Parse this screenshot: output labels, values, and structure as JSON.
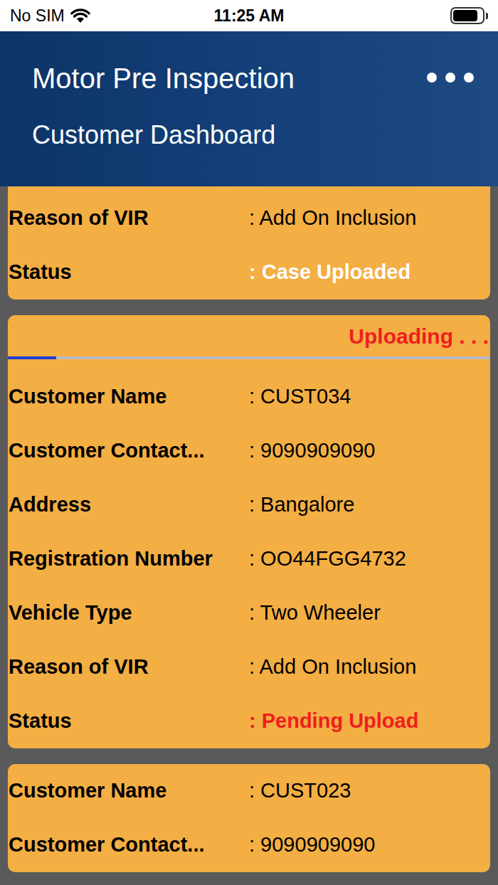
{
  "status_bar": {
    "carrier": "No SIM",
    "time": "11:25 AM",
    "battery_level": 0.85
  },
  "header": {
    "title": "Motor Pre Inspection",
    "subtitle": "Customer Dashboard"
  },
  "cases": [
    {
      "uploading": false,
      "rows": [
        {
          "label": "Reason of VIR",
          "value": ": Add On Inclusion",
          "kind": "field"
        },
        {
          "label": "Status",
          "value": ": Case Uploaded",
          "kind": "done"
        }
      ]
    },
    {
      "uploading": true,
      "upload_label": "Uploading . . .",
      "level": 0.1,
      "rows": [
        {
          "label": "Customer Name",
          "value": ": CUST034",
          "kind": "field"
        },
        {
          "label": "Customer Contact...",
          "value": ": 9090909090",
          "kind": "field"
        },
        {
          "label": "Address",
          "value": ": Bangalore",
          "kind": "field"
        },
        {
          "label": "Registration Number",
          "value": ": OO44FGG4732",
          "kind": "field"
        },
        {
          "label": "Vehicle Type",
          "value": ": Two Wheeler",
          "kind": "field"
        },
        {
          "label": "Reason of VIR",
          "value": ": Add On Inclusion",
          "kind": "field"
        },
        {
          "label": "Status",
          "value": ": Pending Upload",
          "kind": "pending"
        }
      ]
    },
    {
      "uploading": false,
      "rows": [
        {
          "label": "Customer Name",
          "value": ": CUST023",
          "kind": "field"
        },
        {
          "label": "Customer Contact...",
          "value": ": 9090909090",
          "kind": "field"
        }
      ]
    }
  ]
}
